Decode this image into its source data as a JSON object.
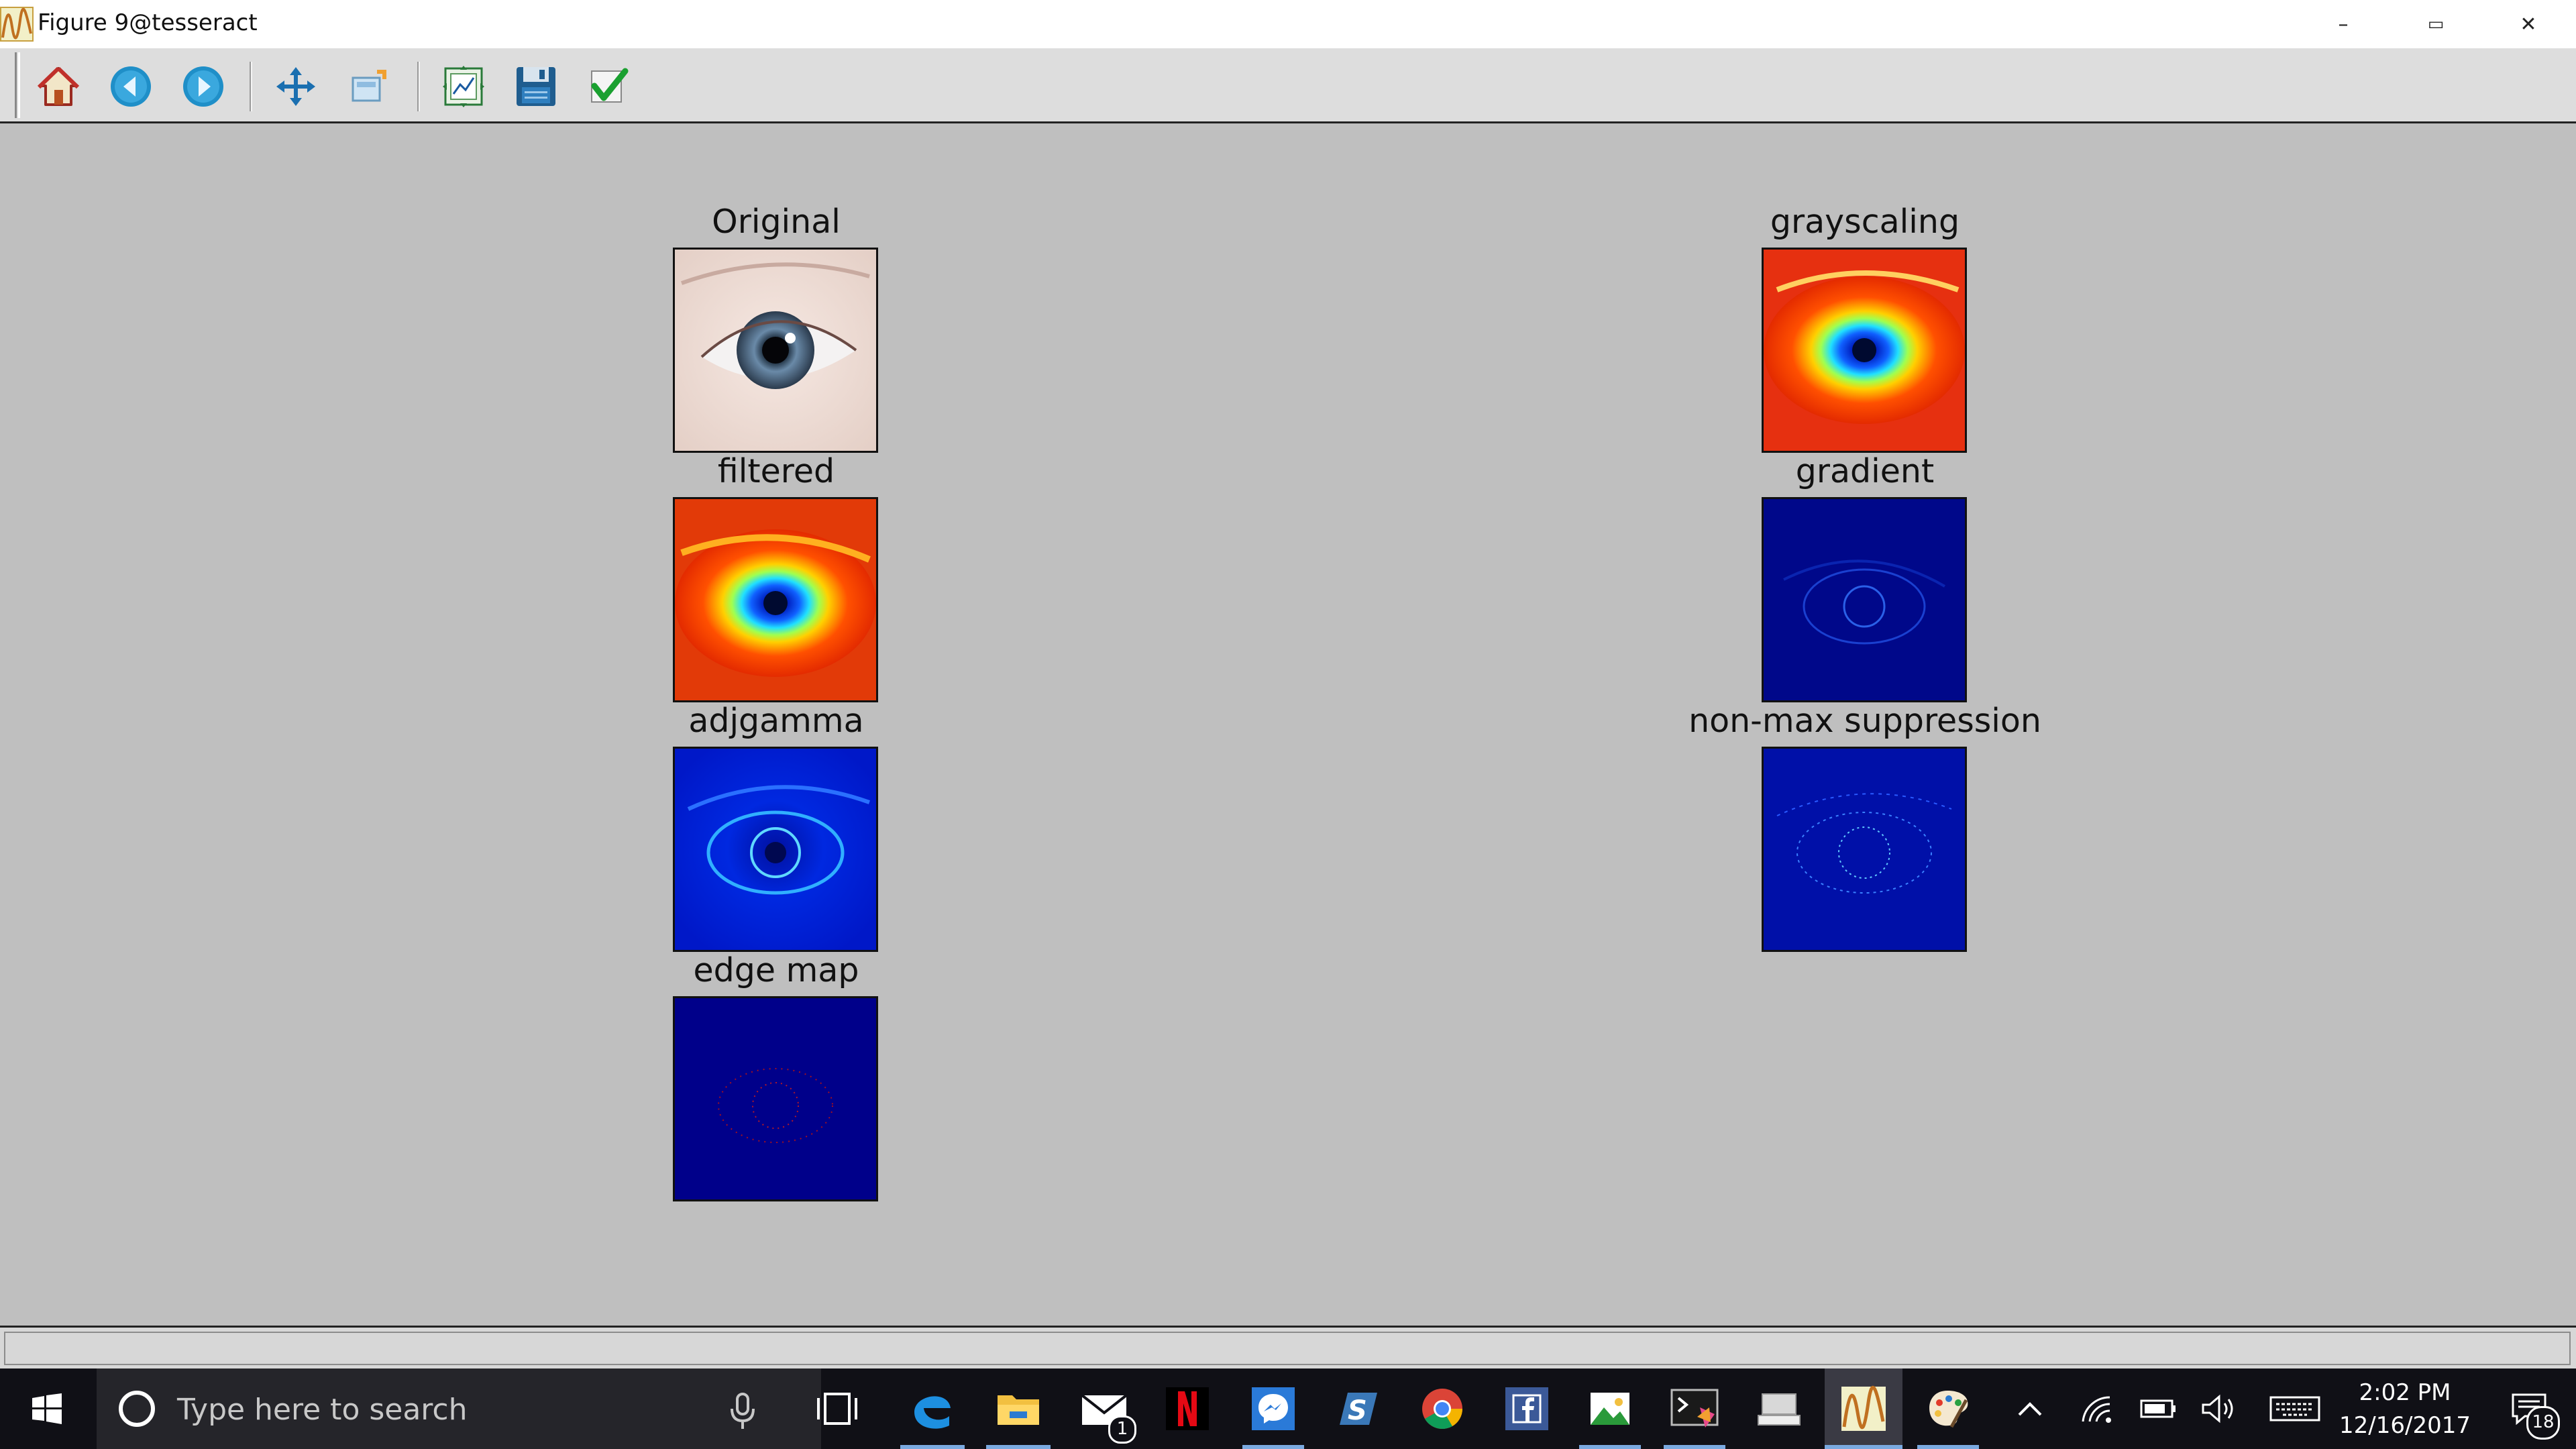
{
  "window": {
    "title": "Figure 9@tesseract",
    "controls": {
      "minimize": "–",
      "restore": "▭",
      "close": "✕"
    }
  },
  "toolbar": {
    "buttons": [
      {
        "name": "home",
        "icon": "home-icon"
      },
      {
        "name": "back",
        "icon": "back-arrow-icon"
      },
      {
        "name": "forward",
        "icon": "forward-arrow-icon"
      },
      {
        "name": "pan",
        "icon": "move-cross-icon"
      },
      {
        "name": "zoom",
        "icon": "zoom-rect-icon"
      },
      {
        "name": "subplots",
        "icon": "subplots-icon"
      },
      {
        "name": "save",
        "icon": "floppy-disk-icon"
      },
      {
        "name": "edit",
        "icon": "checkmark-icon"
      }
    ]
  },
  "figure": {
    "panels": [
      {
        "title": "Original",
        "image": "eye photo"
      },
      {
        "title": "grayscaling",
        "image": "jet-colormap eye"
      },
      {
        "title": "filtered",
        "image": "jet-colormap eye"
      },
      {
        "title": "gradient",
        "image": "dark blue gradient map"
      },
      {
        "title": "adjgamma",
        "image": "blue gamma-adjusted eye"
      },
      {
        "title": "non-max suppression",
        "image": "blue speckled map"
      },
      {
        "title": "edge map",
        "image": "dark blue with sparse red edges"
      }
    ]
  },
  "taskbar": {
    "search_placeholder": "Type here to search",
    "mail_badge": "1",
    "time": "2:02 PM",
    "date": "12/16/2017",
    "notification_count": "18"
  }
}
